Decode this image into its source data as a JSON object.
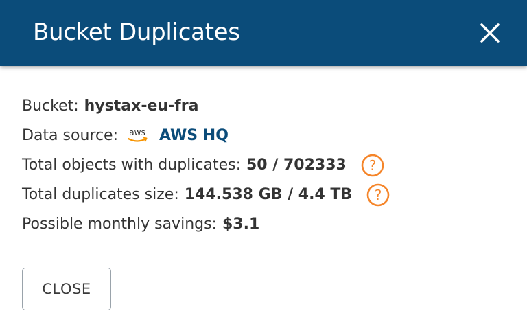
{
  "dialog": {
    "title": "Bucket Duplicates",
    "close_icon": "close-icon"
  },
  "details": {
    "bucket_label": "Bucket:",
    "bucket_value": "hystax-eu-fra",
    "data_source_label": "Data source:",
    "data_source_icon": "aws-logo-icon",
    "data_source_logo_text": "aws",
    "data_source_value": "AWS HQ",
    "total_objects_label": "Total objects with duplicates:",
    "total_objects_value": "50 / 702333",
    "total_size_label": "Total duplicates size:",
    "total_size_value": "144.538 GB / 4.4 TB",
    "savings_label": "Possible monthly savings:",
    "savings_value": "$3.1",
    "help_icon": "question-circle-icon"
  },
  "actions": {
    "close_label": "CLOSE"
  },
  "colors": {
    "header_bg": "#0b4c7a",
    "link": "#0b4c7a",
    "help_icon": "#f5852a",
    "aws_orange": "#f79400"
  }
}
